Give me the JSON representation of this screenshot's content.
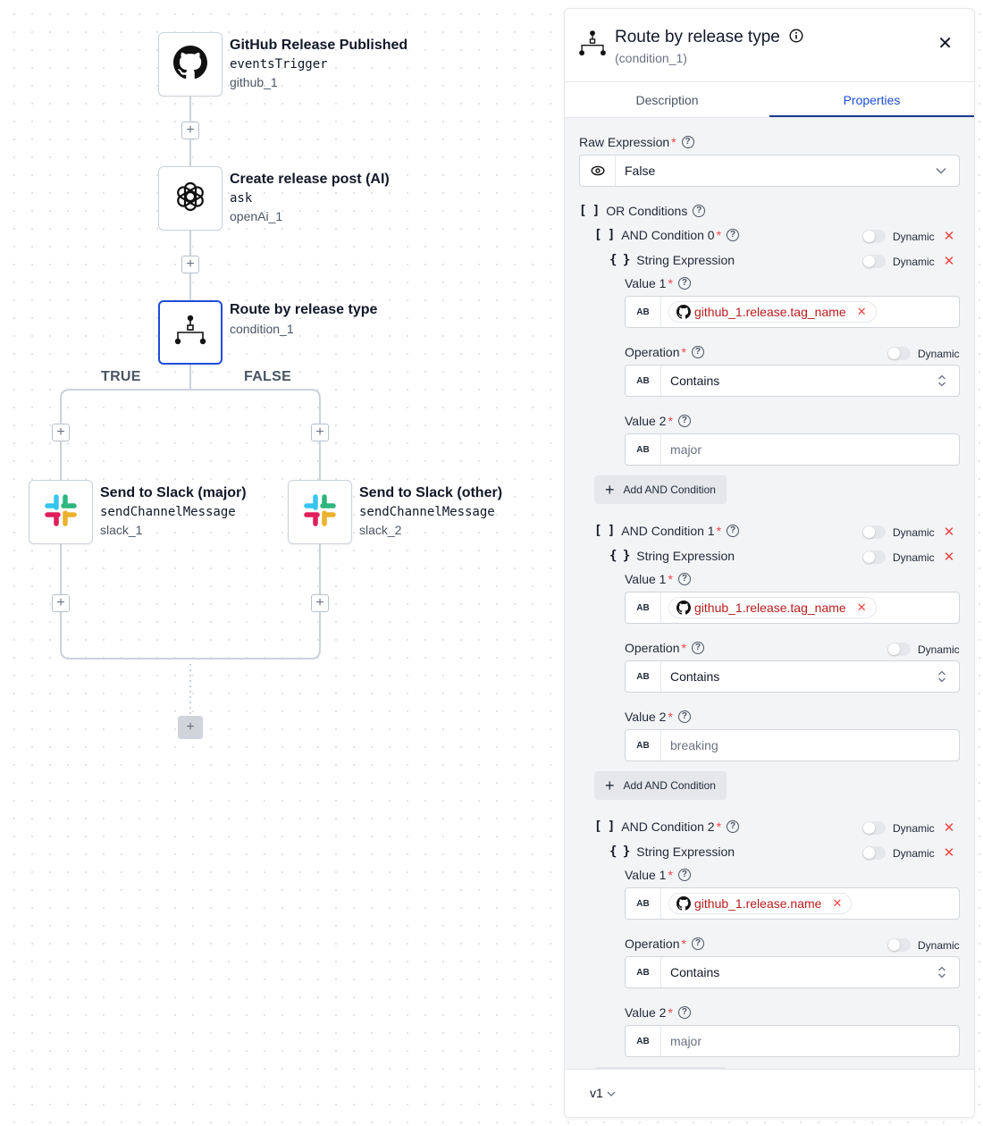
{
  "canvas": {
    "nodes": [
      {
        "title": "GitHub Release Published",
        "action": "eventsTrigger",
        "id": "github_1",
        "icon": "github-icon"
      },
      {
        "title": "Create release post (AI)",
        "action": "ask",
        "id": "openAi_1",
        "icon": "openai-icon"
      },
      {
        "title": "Route by release type",
        "action": "",
        "id": "condition_1",
        "icon": "condition-icon"
      },
      {
        "title": "Send to Slack (major)",
        "action": "sendChannelMessage",
        "id": "slack_1",
        "icon": "slack-icon"
      },
      {
        "title": "Send to Slack (other)",
        "action": "sendChannelMessage",
        "id": "slack_2",
        "icon": "slack-icon"
      }
    ],
    "branches": {
      "true_label": "TRUE",
      "false_label": "FALSE"
    },
    "add_symbol": "+"
  },
  "panel": {
    "title": "Route by release type",
    "subtitle": "(condition_1)",
    "close": "✕",
    "tabs": [
      {
        "label": "Description",
        "active": false
      },
      {
        "label": "Properties",
        "active": true
      }
    ],
    "raw_expression": {
      "label": "Raw Expression",
      "value": "False"
    },
    "or_conditions_label": "OR Conditions",
    "dynamic_label": "Dynamic",
    "ab_label": "AB",
    "string_expression_label": "String Expression",
    "value1_label": "Value 1",
    "operation_label": "Operation",
    "value2_label": "Value 2",
    "add_and_label": "Add AND Condition",
    "and_conditions": [
      {
        "label": "AND Condition 0",
        "value1": "github_1.release.tag_name",
        "operation": "Contains",
        "value2": "major"
      },
      {
        "label": "AND Condition 1",
        "value1": "github_1.release.tag_name",
        "operation": "Contains",
        "value2": "breaking"
      },
      {
        "label": "AND Condition 2",
        "value1": "github_1.release.name",
        "operation": "Contains",
        "value2": "major"
      }
    ],
    "version": "v1"
  },
  "colors": {
    "accent": "#1d4ed8",
    "danger": "#ef4444",
    "chip_text": "#b91c1c"
  }
}
